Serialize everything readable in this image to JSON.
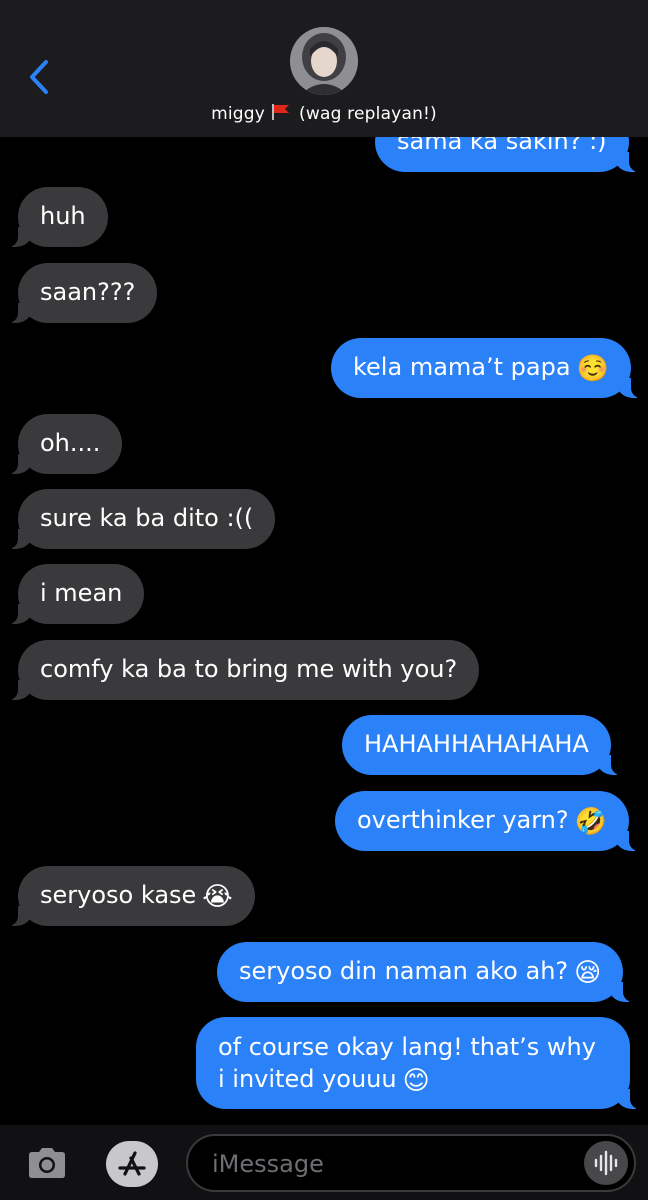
{
  "header": {
    "contact_name": "miggy",
    "contact_note": "(wag replayan!)",
    "flag_icon": "red-flag"
  },
  "messages": [
    {
      "direction": "out",
      "text": "sama ka sakin? :)"
    },
    {
      "direction": "in",
      "text": "huh"
    },
    {
      "direction": "in",
      "text": "saan???"
    },
    {
      "direction": "out",
      "text": "kela mama’t papa",
      "emoji": "☺️"
    },
    {
      "direction": "in",
      "text": "oh...."
    },
    {
      "direction": "in",
      "text": "sure ka ba dito :(("
    },
    {
      "direction": "in",
      "text": "i mean"
    },
    {
      "direction": "in",
      "text": "comfy ka ba to bring me with you?"
    },
    {
      "direction": "out",
      "text": "HAHAHHAHAHAHA"
    },
    {
      "direction": "out",
      "text": "overthinker yarn?",
      "emoji": "🤣"
    },
    {
      "direction": "in",
      "text": "seryoso kase",
      "emoji": "😭"
    },
    {
      "direction": "out",
      "text": "seryoso din naman ako ah?",
      "emoji": "😪"
    },
    {
      "direction": "out",
      "text": "of course okay lang! that’s why i invited youuu",
      "emoji": "😊"
    }
  ],
  "input": {
    "placeholder": "iMessage"
  },
  "colors": {
    "incoming_bubble": "#3a3a3c",
    "outgoing_bubble": "#2b81f7",
    "accent": "#2b81f7",
    "background": "#000000"
  }
}
